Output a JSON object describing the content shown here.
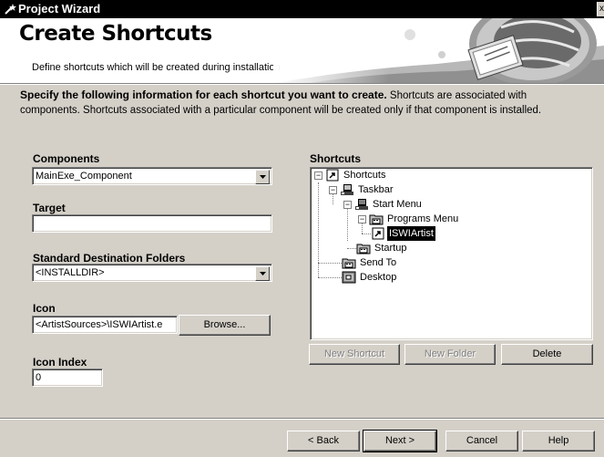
{
  "window": {
    "title": "Project Wizard",
    "close_glyph": "x"
  },
  "header": {
    "title": "Create Shortcuts",
    "subtitle": "Define shortcuts which will be created during installation"
  },
  "instructions": {
    "bold_text": "Specify the following information for each shortcut you want to create.",
    "text": "Shortcuts are associated with components. Shortcuts associated with a particular component will be created only if that component is installed."
  },
  "form": {
    "components": {
      "label": "Components",
      "value": "MainExe_Component"
    },
    "target": {
      "label": "Target",
      "value": ""
    },
    "destination": {
      "label": "Standard Destination Folders",
      "value": "<INSTALLDIR>"
    },
    "icon": {
      "label": "Icon",
      "value": "<ArtistSources>\\ISWIArtist.e",
      "browse_label": "Browse..."
    },
    "icon_index": {
      "label": "Icon Index",
      "value": "0"
    }
  },
  "shortcuts": {
    "label": "Shortcuts",
    "tree": [
      {
        "label": "Shortcuts",
        "icon": "shortcut-icon",
        "expander": "−"
      },
      {
        "label": "Taskbar",
        "icon": "taskbar-icon",
        "expander": "−"
      },
      {
        "label": "Start Menu",
        "icon": "start-menu-icon",
        "expander": "−"
      },
      {
        "label": "Programs Menu",
        "icon": "folder-icon",
        "expander": "−"
      },
      {
        "label": "ISWIArtist",
        "icon": "shortcut-icon",
        "selected": true
      },
      {
        "label": "Startup",
        "icon": "folder-icon"
      },
      {
        "label": "Send To",
        "icon": "folder-icon"
      },
      {
        "label": "Desktop",
        "icon": "desktop-icon"
      }
    ],
    "new_shortcut_label": "New Shortcut",
    "new_folder_label": "New Folder",
    "delete_label": "Delete"
  },
  "footer": {
    "back_label": "< Back",
    "next_label": "Next >",
    "cancel_label": "Cancel",
    "help_label": "Help"
  },
  "colors": {
    "dialog_bg": "#d4d0c8",
    "titlebar_bg": "#000000",
    "header_bg": "#ffffff",
    "selection_bg": "#000000"
  }
}
